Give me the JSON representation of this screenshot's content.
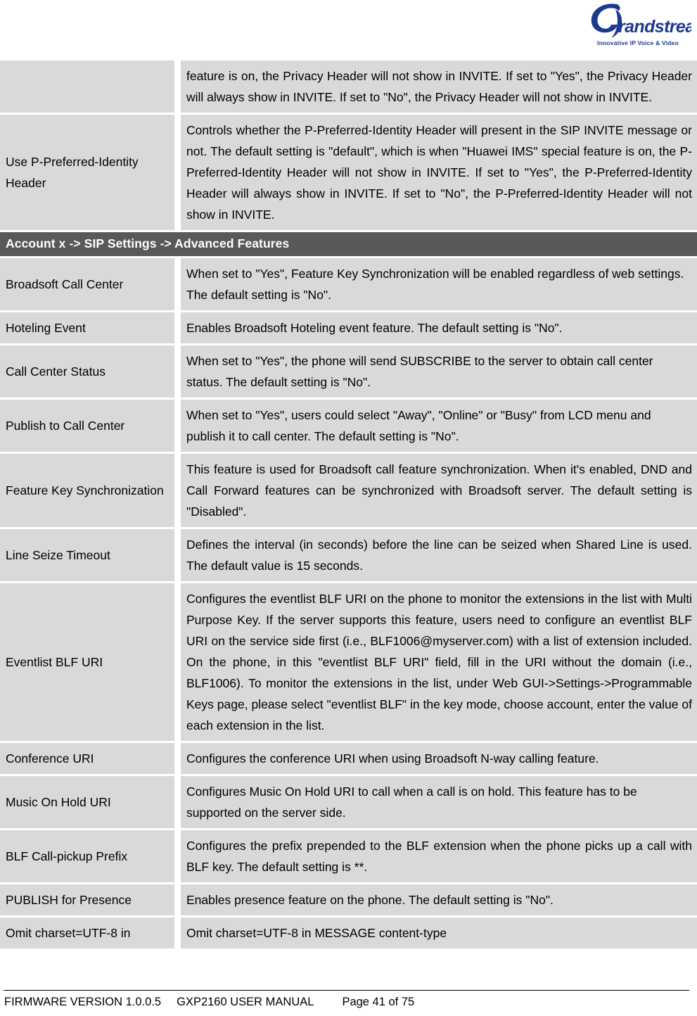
{
  "brand": {
    "name": "Grandstream",
    "tagline": "Innovative IP Voice & Video",
    "logo_color": "#1a3a8f"
  },
  "colors": {
    "cell_background": "#d9d9d9",
    "section_background": "#595959",
    "section_text": "#ffffff",
    "page_background": "#ffffff"
  },
  "table": {
    "continued_row": {
      "label": "",
      "description": "feature is on, the Privacy Header will not show in INVITE. If set to \"Yes\", the Privacy Header will always show in INVITE. If set to \"No\", the Privacy Header will not show in INVITE."
    },
    "rows_before_section": [
      {
        "label": "Use P-Preferred-Identity Header",
        "description": "Controls whether the P-Preferred-Identity Header will present in the SIP INVITE message or not. The default setting is \"default\", which is when \"Huawei IMS\" special feature is on, the P-Preferred-Identity Header will not show in INVITE. If set to \"Yes\", the P-Preferred-Identity Header will always show in INVITE. If set to \"No\", the P-Preferred-Identity Header will not show in INVITE."
      }
    ],
    "section_header": "Account x -> SIP Settings -> Advanced Features",
    "rows_after_section": [
      {
        "label": "Broadsoft Call Center",
        "description": "When set to \"Yes\", Feature Key Synchronization will be enabled regardless of web settings. The default setting is \"No\"."
      },
      {
        "label": "Hoteling Event",
        "description": "Enables Broadsoft Hoteling event feature. The default setting is \"No\"."
      },
      {
        "label": "Call Center Status",
        "description": "When set to \"Yes\", the phone will send SUBSCRIBE to the server to obtain call center status. The default setting is \"No\"."
      },
      {
        "label": "Publish to Call Center",
        "description": "When set to \"Yes\", users could select \"Away\", \"Online\" or \"Busy\" from LCD menu and publish it to call center. The default setting is \"No\"."
      },
      {
        "label": "Feature Key Synchronization",
        "description": "This feature is used for Broadsoft call feature synchronization. When it's enabled, DND and Call Forward features can be synchronized with Broadsoft server. The default setting is \"Disabled\"."
      },
      {
        "label": "Line Seize Timeout",
        "description": "Defines the interval (in seconds) before the line can be seized when Shared Line is used. The default value is 15 seconds."
      },
      {
        "label": "Eventlist BLF URI",
        "description": "Configures the eventlist BLF URI on the phone to monitor the extensions in the list with Multi Purpose Key. If the server supports this feature, users need to configure an eventlist BLF URI on the service side first (i.e., BLF1006@myserver.com) with a list of extension included. On the phone, in this \"eventlist BLF URI\" field, fill in the URI without the domain (i.e., BLF1006). To monitor the extensions in the list, under Web GUI->Settings->Programmable Keys page, please select \"eventlist BLF\" in the key mode, choose account, enter the value of each extension in the list."
      },
      {
        "label": "Conference URI",
        "description": "Configures the conference URI when using Broadsoft N-way calling feature."
      },
      {
        "label": "Music On Hold URI",
        "description": "Configures Music On Hold URI to call when a call is on hold. This feature has to be supported on the server side."
      },
      {
        "label": "BLF Call-pickup Prefix",
        "description": "Configures the prefix prepended to the BLF extension when the phone picks up a call with BLF key. The default setting is **."
      },
      {
        "label": "PUBLISH for Presence",
        "description": "Enables presence feature on the phone. The default setting is \"No\"."
      },
      {
        "label": "Omit charset=UTF-8 in",
        "description": "Omit charset=UTF-8 in MESSAGE content-type"
      }
    ]
  },
  "footer": {
    "firmware": "FIRMWARE VERSION 1.0.0.5",
    "manual": "GXP2160 USER MANUAL",
    "page": "Page 41 of 75"
  }
}
